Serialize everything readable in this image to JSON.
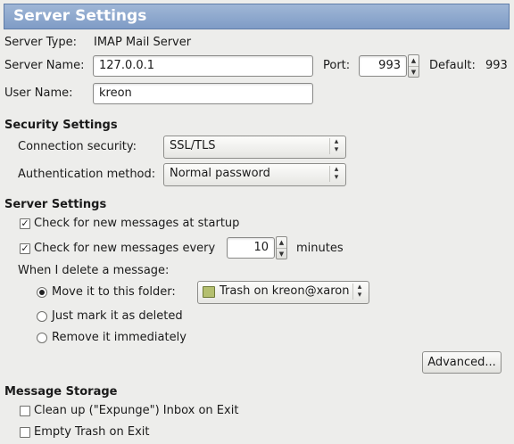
{
  "header": {
    "title": "Server Settings"
  },
  "server": {
    "type_label": "Server Type:",
    "type_value": "IMAP Mail Server",
    "name_label": "Server Name:",
    "name_value": "127.0.0.1",
    "port_label": "Port:",
    "port_value": "993",
    "default_label": "Default:",
    "default_value": "993",
    "user_label": "User Name:",
    "user_value": "kreon"
  },
  "security": {
    "heading": "Security Settings",
    "connection_label": "Connection security:",
    "connection_value": "SSL/TLS",
    "auth_label": "Authentication method:",
    "auth_value": "Normal password"
  },
  "settings": {
    "heading": "Server Settings",
    "check_startup_label": "Check for new messages at startup",
    "check_startup_checked": true,
    "check_every_label": "Check for new messages every",
    "check_every_checked": true,
    "check_every_value": "10",
    "minutes_label": "minutes",
    "delete_label": "When I delete a message:",
    "move_label": "Move it to this folder:",
    "move_selected": true,
    "folder_value": "Trash on kreon@xaron",
    "mark_label": "Just mark it as deleted",
    "remove_label": "Remove it immediately",
    "advanced_label": "Advanced..."
  },
  "storage": {
    "heading": "Message Storage",
    "expunge_label": "Clean up (\"Expunge\") Inbox on Exit",
    "expunge_checked": false,
    "empty_trash_label": "Empty Trash on Exit",
    "empty_trash_checked": false
  },
  "icons": {
    "checkmark": "✓",
    "spin_up": "▲",
    "spin_down": "▼",
    "combo_up": "▴",
    "combo_down": "▾"
  }
}
